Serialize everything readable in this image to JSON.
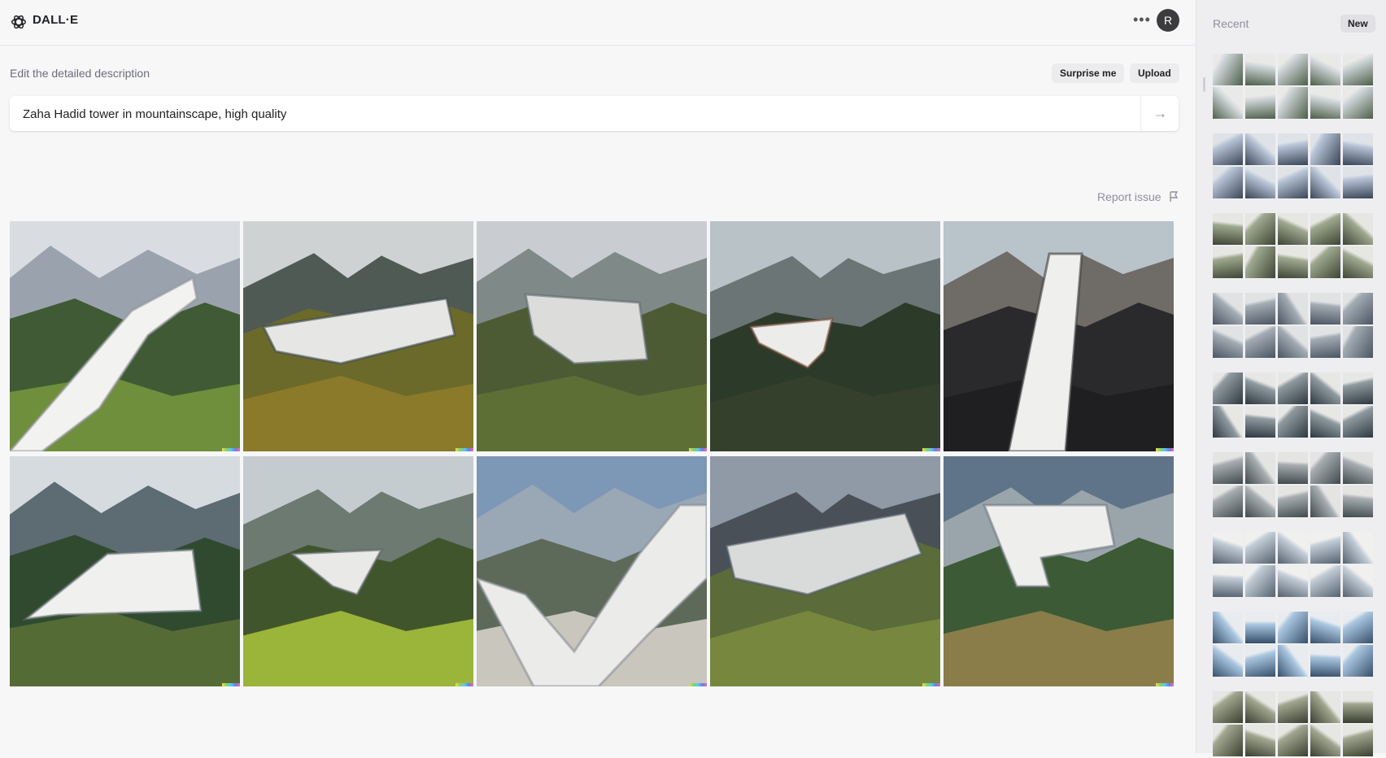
{
  "app": {
    "name": "DALL·E",
    "avatar_initial": "R",
    "more_icon": "ellipsis-icon"
  },
  "editor": {
    "hint": "Edit the detailed description",
    "surprise_label": "Surprise me",
    "upload_label": "Upload",
    "prompt_value": "Zaha Hadid tower in mountainscape, high quality",
    "submit_icon": "arrow-right-icon",
    "report_label": "Report issue",
    "report_icon": "flag-icon"
  },
  "results": [
    {
      "sky": "#d9dde2",
      "far": "#9aa3ad",
      "mid": "#3f5a35",
      "ground": "#6f8f3c",
      "building": "#f2f2f0",
      "shadow": "#8f959a"
    },
    {
      "sky": "#cfd2d3",
      "far": "#4f5a55",
      "mid": "#6c6a2a",
      "ground": "#8a7a2a",
      "building": "#e6e6e4",
      "shadow": "#3c4a52"
    },
    {
      "sky": "#c9cdd2",
      "far": "#7f8a88",
      "mid": "#4c5b34",
      "ground": "#5e6f35",
      "building": "#dcdcda",
      "shadow": "#5e6a70"
    },
    {
      "sky": "#b9c2c6",
      "far": "#6b7575",
      "mid": "#2c3a2a",
      "ground": "#35402c",
      "building": "#ececea",
      "shadow": "#7a4c3a"
    },
    {
      "sky": "#b9c3ca",
      "far": "#6f6b66",
      "mid": "#2a2a2c",
      "ground": "#1f1f22",
      "building": "#efefed",
      "shadow": "#3a3a3c"
    },
    {
      "sky": "#d6dbe0",
      "far": "#5d6b72",
      "mid": "#2f4a2e",
      "ground": "#556b36",
      "building": "#f0f0ee",
      "shadow": "#6d7479"
    },
    {
      "sky": "#c5ccd0",
      "far": "#6c7a72",
      "mid": "#41552c",
      "ground": "#9bb43a",
      "building": "#e9e9e7",
      "shadow": "#5a6468"
    },
    {
      "sky": "#7d98b6",
      "far": "#9aa7b4",
      "mid": "#5d6a5a",
      "ground": "#c8c6bd",
      "building": "#ebebe9",
      "shadow": "#8b9096"
    },
    {
      "sky": "#8f9aa6",
      "far": "#4a5057",
      "mid": "#5b6b3a",
      "ground": "#77883e",
      "building": "#d9dada",
      "shadow": "#4b5a66"
    },
    {
      "sky": "#5f7488",
      "far": "#9aa4ab",
      "mid": "#3b5a35",
      "ground": "#8a7d4a",
      "building": "#eeeeec",
      "shadow": "#6f7a82"
    }
  ],
  "sidebar": {
    "title": "Recent",
    "new_label": "New",
    "history": [
      [
        "#cfd6d8",
        "#4d5f4a",
        "#e9e9e7"
      ],
      [
        "#b7c3d6",
        "#3a4657",
        "#dfe2e6"
      ],
      [
        "#9fa88f",
        "#3e4535",
        "#e6e6e2"
      ],
      [
        "#a3acb4",
        "#4b5562",
        "#e0e2e3"
      ],
      [
        "#8f9aa0",
        "#2f3840",
        "#e7e7e5"
      ],
      [
        "#a7adb0",
        "#404a4c",
        "#e4e4e2"
      ],
      [
        "#c2ccd6",
        "#55626f",
        "#f0f0ee"
      ],
      [
        "#a9c6e0",
        "#38506a",
        "#e9ecef"
      ],
      [
        "#a1a690",
        "#3a4030",
        "#e6e6e2"
      ]
    ]
  }
}
